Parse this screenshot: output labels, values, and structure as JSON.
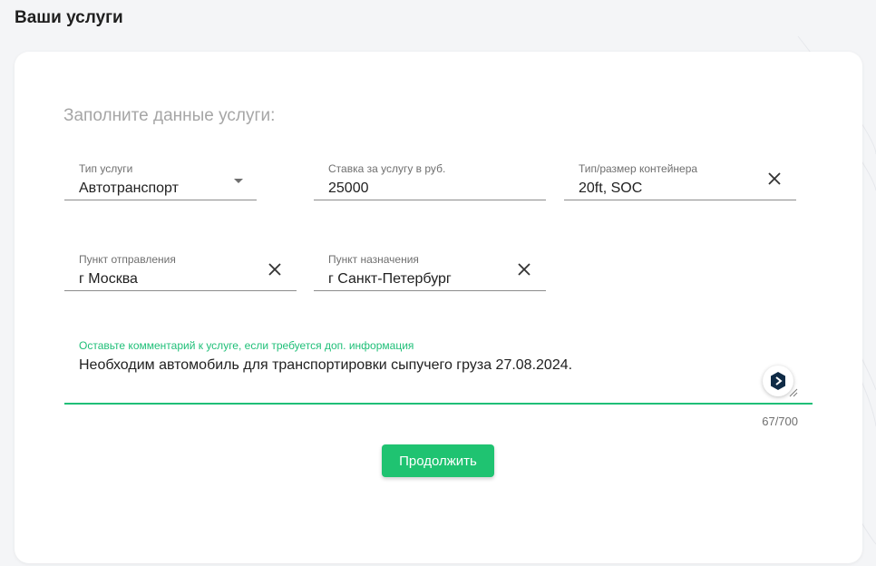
{
  "page": {
    "title": "Ваши услуги"
  },
  "form": {
    "heading": "Заполните данные услуги:",
    "service_type": {
      "label": "Тип услуги",
      "value": "Автотранспорт",
      "icon": "dropdown-arrow-icon"
    },
    "rate": {
      "label": "Ставка за услугу в руб.",
      "value": "25000"
    },
    "container": {
      "label": "Тип/размер контейнера",
      "value": "20ft, SOC",
      "icon": "clear-icon"
    },
    "origin": {
      "label": "Пункт отправления",
      "value": "г Москва",
      "icon": "clear-icon"
    },
    "destination": {
      "label": "Пункт назначения",
      "value": "г Санкт-Петербург",
      "icon": "clear-icon"
    },
    "comment": {
      "label": "Оставьте комментарий к услуге, если требуется доп. информация",
      "value": "Необходим автомобиль для транспортировки сыпучего груза 27.08.2024.",
      "counter": "67/700",
      "icon": "assistant-icon"
    },
    "submit_label": "Продолжить"
  },
  "colors": {
    "accent": "#1fc371",
    "focus_label": "#1fbf78",
    "background": "#f4f5f7",
    "card": "#ffffff"
  }
}
